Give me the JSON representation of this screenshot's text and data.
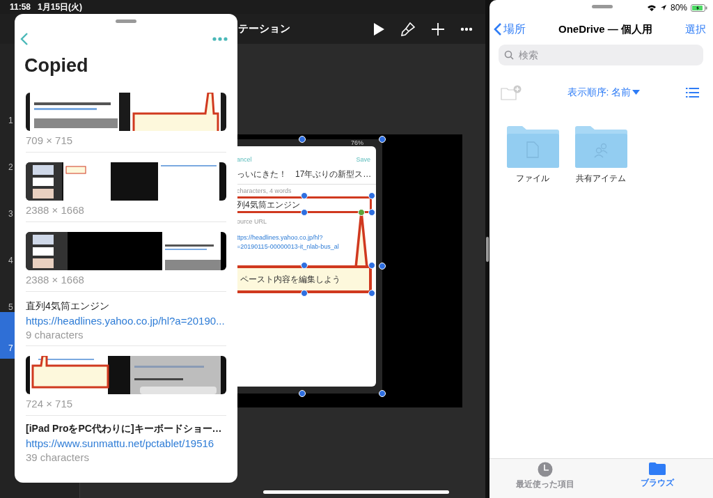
{
  "status_bar": {
    "time": "11:58",
    "date": "1月15日(火)"
  },
  "presentation": {
    "title": "テーション",
    "slides": [
      {
        "number": "1",
        "selected": false
      },
      {
        "number": "2",
        "selected": false
      },
      {
        "number": "3",
        "selected": false
      },
      {
        "number": "4",
        "selected": false
      },
      {
        "number": "5",
        "selected": false
      },
      {
        "number": "7",
        "selected": true
      }
    ],
    "screenshot": {
      "battery": "76%",
      "cancel": "ancel",
      "save": "Save",
      "title": "っいにきた！　17年ぶりの新型ス…",
      "stats": "characters, 4 words",
      "body": "列4気筒エンジン",
      "source_label": "ource URL",
      "url_lines": [
        "ttps://headlines.yahoo.co.jp/hl?",
        "=20190115-00000013-it_nlab-bus_al"
      ]
    },
    "callout": "ペースト内容を編集しよう"
  },
  "clipboard_panel": {
    "title": "Copied",
    "items": [
      {
        "size": "709 × 715"
      },
      {
        "size": "2388 × 1668"
      },
      {
        "size": "2388 × 1668"
      },
      {
        "kind": "text",
        "text": "直列4気筒エンジン",
        "bold": false,
        "url": "https://headlines.yahoo.co.jp/hl?a=20190...",
        "count": "9 characters"
      },
      {
        "size": "724 × 715"
      },
      {
        "kind": "text",
        "text": "[iPad ProをPC代わりに]キーボードショー…",
        "bold": true,
        "url": "https://www.sunmattu.net/pctablet/19516",
        "count": "39 characters"
      }
    ]
  },
  "files": {
    "battery": "80%",
    "back": "場所",
    "title": "OneDrive — 個人用",
    "action": "選択",
    "search_placeholder": "検索",
    "sort": "表示順序: 名前",
    "folders": [
      {
        "name": "ファイル",
        "kind": "document"
      },
      {
        "name": "共有アイテム",
        "kind": "shared"
      }
    ],
    "tabs": [
      {
        "label": "最近使った項目",
        "kind": "recent",
        "selected": false
      },
      {
        "label": "ブラウズ",
        "kind": "browse",
        "selected": true
      }
    ]
  }
}
